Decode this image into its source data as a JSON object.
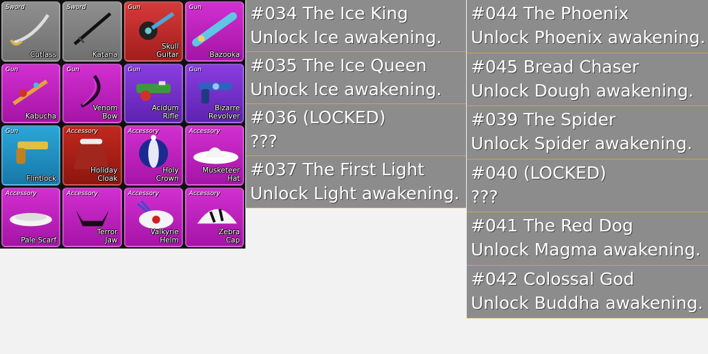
{
  "items": [
    {
      "category": "Sword",
      "name": "Cutlass",
      "color": "gray",
      "icon": "cutlass-icon"
    },
    {
      "category": "Sword",
      "name": "Katana",
      "color": "gray",
      "icon": "katana-icon"
    },
    {
      "category": "Gun",
      "name": "Skull\nGuitar",
      "color": "red",
      "icon": "skull-guitar-icon"
    },
    {
      "category": "Gun",
      "name": "Bazooka",
      "color": "magenta",
      "icon": "bazooka-icon"
    },
    {
      "category": "Gun",
      "name": "Kabucha",
      "color": "magenta",
      "icon": "kabucha-icon"
    },
    {
      "category": "Gun",
      "name": "Venom\nBow",
      "color": "magenta",
      "icon": "venom-bow-icon"
    },
    {
      "category": "Gun",
      "name": "Acidum\nRifle",
      "color": "purple",
      "icon": "acidum-rifle-icon"
    },
    {
      "category": "Gun",
      "name": "Bizarre\nRevolver",
      "color": "purple",
      "icon": "bizarre-revolver-icon"
    },
    {
      "category": "Gun",
      "name": "Flintlock",
      "color": "cyan",
      "icon": "flintlock-icon"
    },
    {
      "category": "Accessory",
      "name": "Holiday\nCloak",
      "color": "darkred",
      "icon": "holiday-cloak-icon"
    },
    {
      "category": "Accessory",
      "name": "Holy\nCrown",
      "color": "magenta",
      "icon": "holy-crown-icon"
    },
    {
      "category": "Accessory",
      "name": "Musketeer\nHat",
      "color": "magenta",
      "icon": "musketeer-hat-icon"
    },
    {
      "category": "Accessory",
      "name": "Pale Scarf",
      "color": "magenta",
      "icon": "pale-scarf-icon"
    },
    {
      "category": "Accessory",
      "name": "Terror\nJaw",
      "color": "magenta",
      "icon": "terror-jaw-icon"
    },
    {
      "category": "Accessory",
      "name": "Valkyrie\nHelm",
      "color": "magenta",
      "icon": "valkyrie-helm-icon"
    },
    {
      "category": "Accessory",
      "name": "Zebra\nCap",
      "color": "magenta",
      "icon": "zebra-cap-icon"
    }
  ],
  "achievements_left": [
    {
      "title": "#034 The Ice King",
      "desc": "Unlock Ice awakening."
    },
    {
      "title": "#035 The Ice Queen",
      "desc": "Unlock Ice awakening."
    },
    {
      "title": "#036 (LOCKED)",
      "desc": "???"
    },
    {
      "title": "#037 The First Light",
      "desc": "Unlock Light awakening."
    }
  ],
  "achievements_right": [
    {
      "title": "#044 The Phoenix",
      "desc": "Unlock Phoenix awakening."
    },
    {
      "title": "#045 Bread Chaser",
      "desc": "Unlock Dough awakening."
    },
    {
      "title": "#039 The Spider",
      "desc": "Unlock Spider awakening."
    },
    {
      "title": "#040 (LOCKED)",
      "desc": "???"
    },
    {
      "title": "#041 The Red Dog",
      "desc": "Unlock Magma awakening."
    },
    {
      "title": "#042 Colossal God",
      "desc": "Unlock Buddha awakening."
    }
  ],
  "colors": {
    "entry_bg": "#8c8c8c",
    "entry_border": "#c9a94b",
    "gray": "#808080",
    "red": "#c22b2b",
    "magenta": "#c021be",
    "purple": "#7433c8",
    "cyan": "#2192c2",
    "darkred": "#a8201a"
  }
}
